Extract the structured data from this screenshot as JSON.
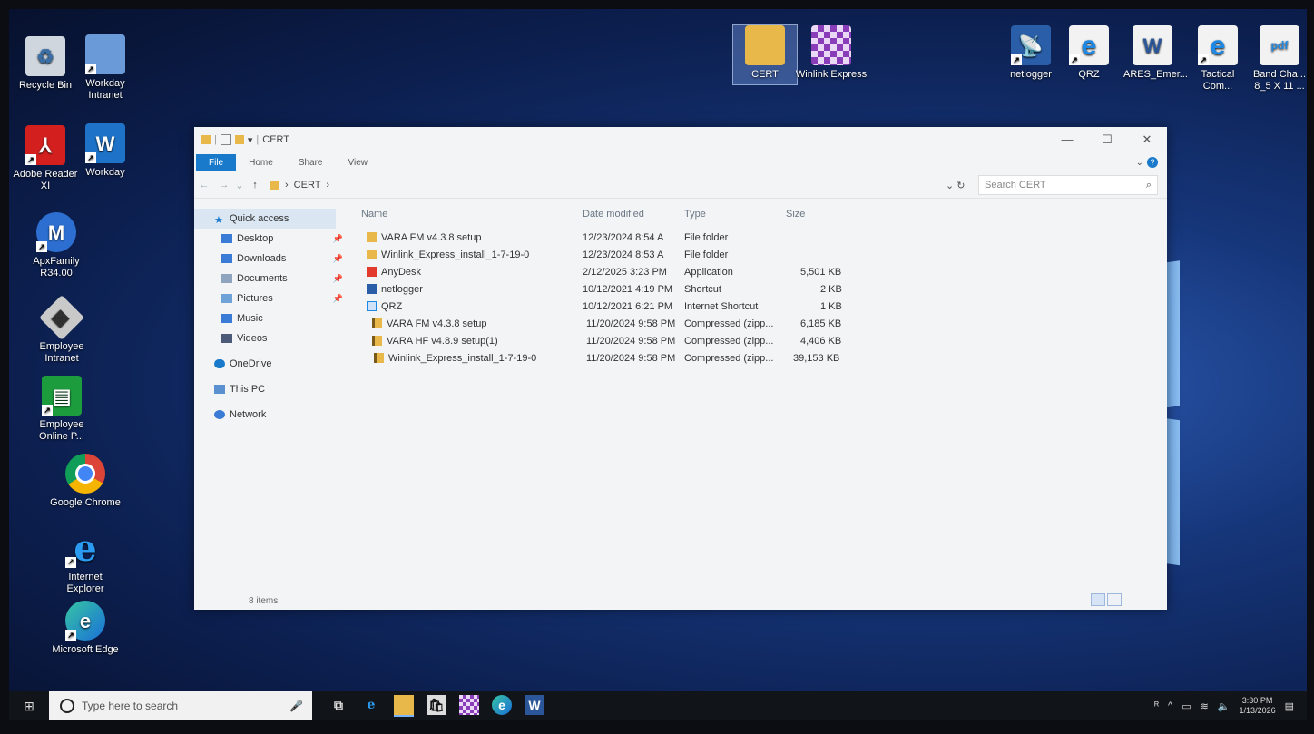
{
  "desktop": {
    "icons_left": [
      {
        "label": "Recycle Bin",
        "icon": "recycle-bin-icon"
      },
      {
        "label": "Workday Intranet",
        "icon": "workday-intranet-icon"
      },
      {
        "label": "Adobe Reader XI",
        "icon": "adobe-reader-icon"
      },
      {
        "label": "Workday",
        "icon": "workday-icon"
      },
      {
        "label": "ApxFamily R34.00",
        "icon": "apx-family-icon"
      },
      {
        "label": "Employee Intranet",
        "icon": "employee-intranet-icon"
      },
      {
        "label": "Employee Online P...",
        "icon": "employee-online-icon"
      },
      {
        "label": "Google Chrome",
        "icon": "chrome-icon"
      },
      {
        "label": "Internet Explorer",
        "icon": "internet-explorer-icon"
      },
      {
        "label": "Microsoft Edge",
        "icon": "edge-icon"
      }
    ],
    "icons_top": [
      {
        "label": "CERT",
        "icon": "folder-icon"
      },
      {
        "label": "Winlink Express",
        "icon": "winlink-icon"
      },
      {
        "label": "netlogger",
        "icon": "netlogger-icon"
      },
      {
        "label": "QRZ",
        "icon": "ie-shortcut-icon"
      },
      {
        "label": "ARES_Emer...",
        "icon": "word-doc-icon"
      },
      {
        "label": "Tactical Com...",
        "icon": "ie-shortcut-icon"
      },
      {
        "label": "Band Cha... 8_5 X 11 ...",
        "icon": "pdf-icon"
      }
    ]
  },
  "explorer": {
    "title": "CERT",
    "ribbon_tabs": [
      "File",
      "Home",
      "Share",
      "View"
    ],
    "path_segment": "CERT",
    "search_placeholder": "Search CERT",
    "nav": {
      "quick_access": "Quick access",
      "pinned": [
        "Desktop",
        "Downloads",
        "Documents",
        "Pictures"
      ],
      "others": [
        "Music",
        "Videos"
      ],
      "onedrive": "OneDrive",
      "this_pc": "This PC",
      "network": "Network"
    },
    "columns": {
      "name": "Name",
      "date": "Date modified",
      "type": "Type",
      "size": "Size"
    },
    "files": [
      {
        "name": "VARA FM v4.3.8 setup",
        "date": "12/23/2024 8:54 A",
        "type": "File folder",
        "size": "",
        "icon": "folder-icon"
      },
      {
        "name": "Winlink_Express_install_1-7-19-0",
        "date": "12/23/2024 8:53 A",
        "type": "File folder",
        "size": "",
        "icon": "folder-icon"
      },
      {
        "name": "AnyDesk",
        "date": "2/12/2025 3:23 PM",
        "type": "Application",
        "size": "5,501 KB",
        "icon": "anydesk-icon"
      },
      {
        "name": "netlogger",
        "date": "10/12/2021 4:19 PM",
        "type": "Shortcut",
        "size": "2 KB",
        "icon": "netlogger-icon"
      },
      {
        "name": "QRZ",
        "date": "10/12/2021 6:21 PM",
        "type": "Internet Shortcut",
        "size": "1 KB",
        "icon": "internet-shortcut-icon"
      },
      {
        "name": "VARA FM v4.3.8 setup",
        "date": "11/20/2024 9:58 PM",
        "type": "Compressed (zipp...",
        "size": "6,185 KB",
        "icon": "zip-folder-icon"
      },
      {
        "name": "VARA HF v4.8.9 setup(1)",
        "date": "11/20/2024 9:58 PM",
        "type": "Compressed (zipp...",
        "size": "4,406 KB",
        "icon": "zip-folder-icon"
      },
      {
        "name": "Winlink_Express_install_1-7-19-0",
        "date": "11/20/2024 9:58 PM",
        "type": "Compressed (zipp...",
        "size": "39,153 KB",
        "icon": "zip-folder-icon"
      }
    ],
    "status": "8 items"
  },
  "taskbar": {
    "search_placeholder": "Type here to search",
    "time": "3:30 PM",
    "date": "1/13/2026"
  },
  "colors": {
    "accent": "#1979ca",
    "folder": "#e8b84a"
  }
}
